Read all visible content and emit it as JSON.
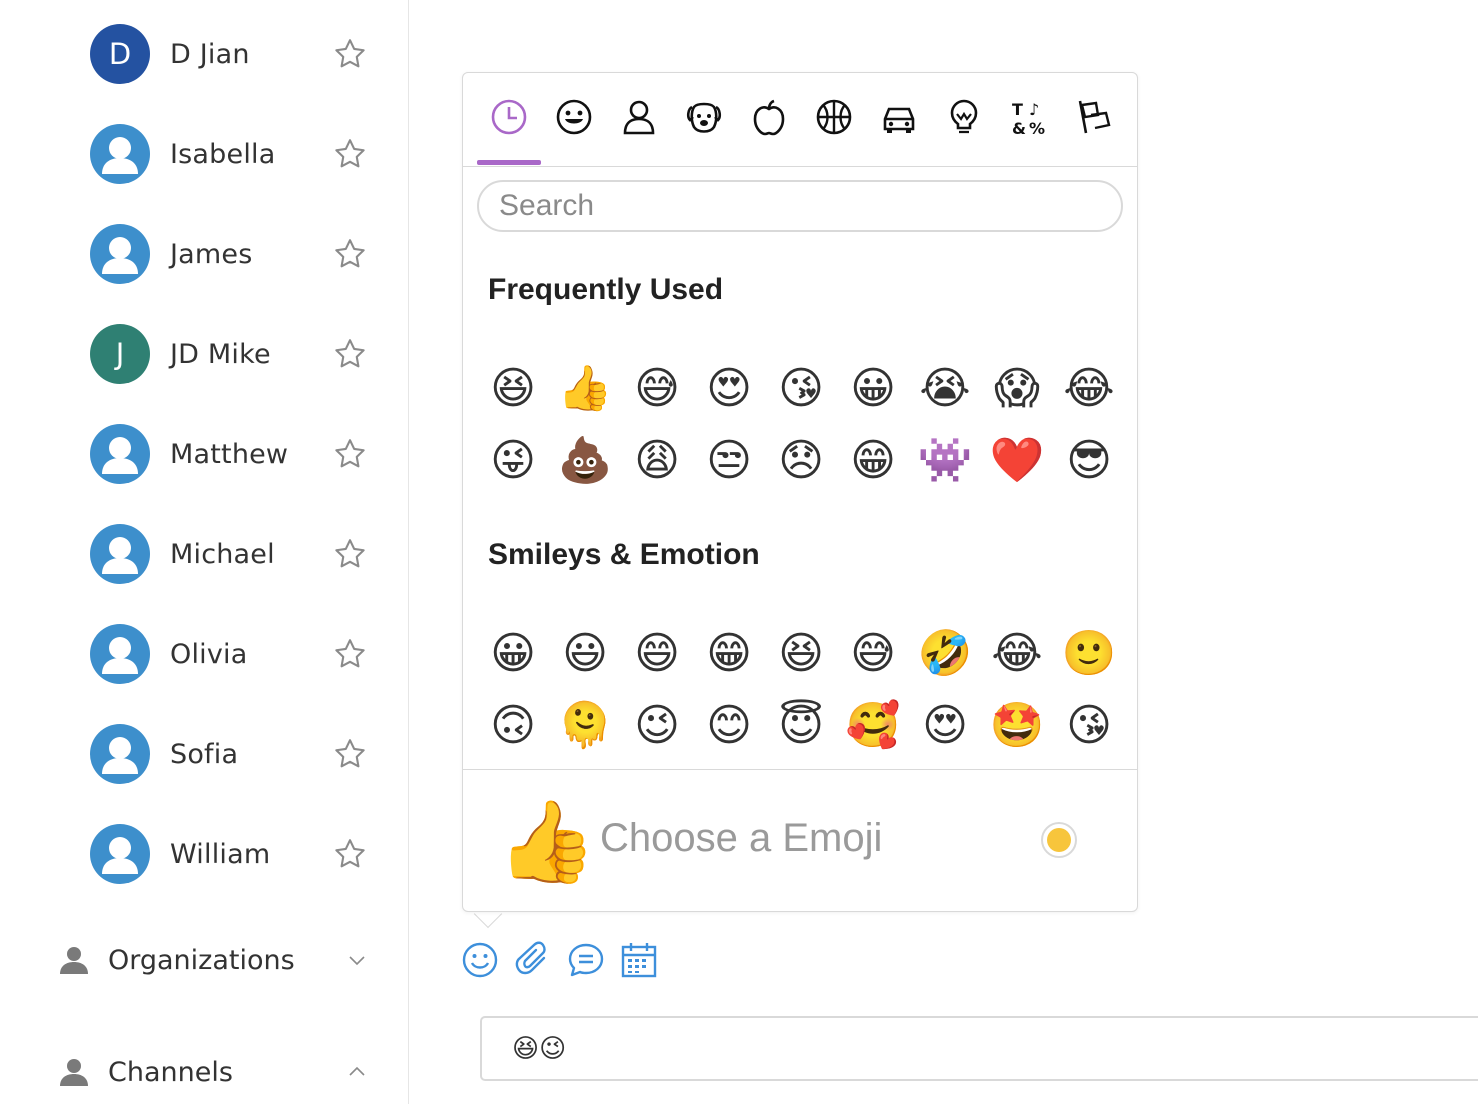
{
  "sidebar": {
    "contacts": [
      {
        "name": "D Jian",
        "initial": "D",
        "avatar_type": "letter",
        "avatar_color": "#2452a1"
      },
      {
        "name": "Isabella",
        "avatar_type": "person-placeholder",
        "avatar_color": "#3d8fcc"
      },
      {
        "name": "James",
        "avatar_type": "person-placeholder",
        "avatar_color": "#3d8fcc"
      },
      {
        "name": "JD Mike",
        "initial": "J",
        "avatar_type": "letter",
        "avatar_color": "#2f8073"
      },
      {
        "name": "Matthew",
        "avatar_type": "person-placeholder",
        "avatar_color": "#3d8fcc"
      },
      {
        "name": "Michael",
        "avatar_type": "person-placeholder",
        "avatar_color": "#3d8fcc"
      },
      {
        "name": "Olivia",
        "avatar_type": "person-placeholder",
        "avatar_color": "#3d8fcc"
      },
      {
        "name": "Sofia",
        "avatar_type": "person-placeholder",
        "avatar_color": "#3d8fcc"
      },
      {
        "name": "William",
        "avatar_type": "person-placeholder",
        "avatar_color": "#3d8fcc"
      }
    ],
    "sections": [
      {
        "label": "Organizations",
        "icon": "person-icon",
        "state": "collapsed"
      },
      {
        "label": "Channels",
        "icon": "person-icon",
        "state": "expanded"
      }
    ]
  },
  "emoji_picker": {
    "categories": [
      "recent-icon",
      "smiley-icon",
      "people-icon",
      "animals-icon",
      "food-icon",
      "activity-icon",
      "travel-icon",
      "objects-icon",
      "symbols-icon",
      "flags-icon"
    ],
    "active_category": "recent-icon",
    "accent_color": "#a968c8",
    "search_placeholder": "Search",
    "sections": [
      {
        "title": "Frequently Used",
        "emojis": [
          "😆",
          "👍",
          "😅",
          "😍",
          "😘",
          "😀",
          "😭",
          "😱",
          "😂",
          "😜",
          "💩",
          "😩",
          "😒",
          "😞",
          "😁",
          "👾",
          "❤️",
          "😎"
        ]
      },
      {
        "title": "Smileys & Emotion",
        "emojis": [
          "😀",
          "😃",
          "😄",
          "😁",
          "😆",
          "😅",
          "🤣",
          "😂",
          "🙂",
          "🙃",
          "🫠",
          "😉",
          "😊",
          "😇",
          "🥰",
          "😍",
          "🤩",
          "😘"
        ]
      }
    ],
    "preview": {
      "emoji": "👍",
      "text": "Choose a Emoji",
      "skin_tone_color": "#f7c53c"
    }
  },
  "toolbar": {
    "tools": [
      "smiley-icon",
      "paperclip-icon",
      "chat-icon",
      "calendar-icon"
    ],
    "icon_color": "#3d8fdb"
  },
  "composer": {
    "text": "😆😉"
  }
}
